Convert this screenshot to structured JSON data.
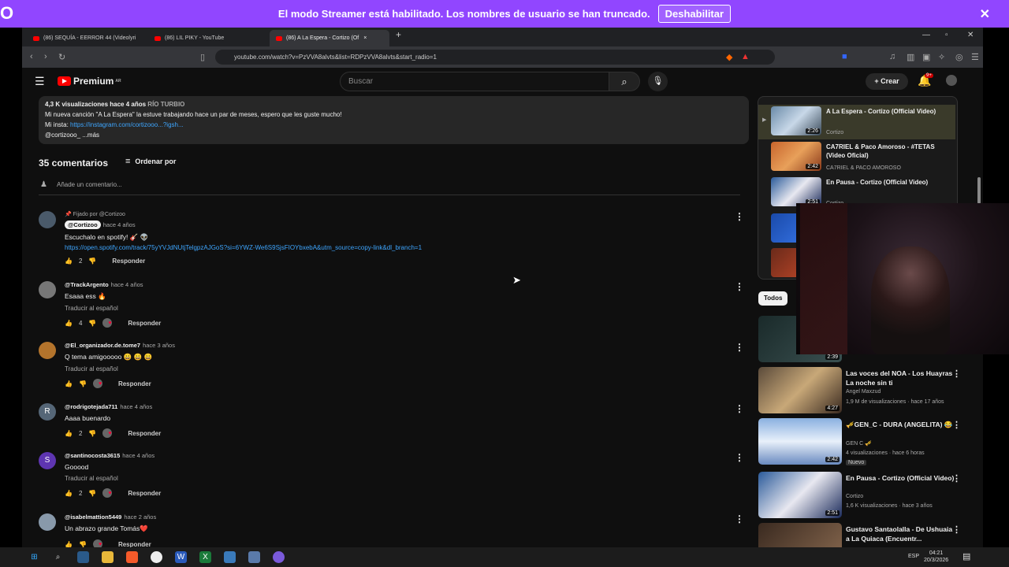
{
  "banner": {
    "logo": "O",
    "text": "El modo Streamer está habilitado. Los nombres de usuario se han truncado.",
    "button": "Deshabilitar",
    "close": "✕"
  },
  "browser": {
    "tabs": [
      "(86) SEQUÍA - EERROR 44 (Videolyri",
      "(86) LIL PIKY - YouTube",
      "(86) A La Espera - Cortizo (Of"
    ],
    "url": "youtube.com/watch?v=PzVVA8alvts&list=RDPzVVA8alvts&start_radio=1"
  },
  "youtube": {
    "logo_text": "Premium",
    "logo_sup": "AR",
    "search_placeholder": "Buscar",
    "create_label": "Crear",
    "notif_badge": "9+"
  },
  "description": {
    "meta": "4,3 K visualizaciones  hace 4 años",
    "tag": "RÍO TURBIO",
    "line1": "Mi nueva canción \"A La Espera\" la estuve trabajando hace un par de meses, espero que les guste mucho!",
    "line2_prefix": "Mi insta: ",
    "line2_link": "https://instagram.com/cortizooo...?igsh...",
    "line3": "@cortizooo_  ...más"
  },
  "comments_header": {
    "count": "35 comentarios",
    "sort": "Ordenar por",
    "add_placeholder": "Añade un comentario..."
  },
  "comments": [
    {
      "pinned": "Fijado por @Cortizoo",
      "author": "@Cortizoo",
      "time": "hace 4 años",
      "text": "Escuchalo en spotify! 🎸 👽",
      "link": "https://open.spotify.com/track/75yYVJdNUtjTelgpzAJGoS?si=6YWZ-We6S9SjsFIOYbxebA&utm_source=copy-link&dl_branch=1",
      "likes": "2",
      "reply": "Responder"
    },
    {
      "author": "@TrackArgento",
      "time": "hace 4 años",
      "text": "Esaaa ess 🔥",
      "translate": "Traducir al español",
      "likes": "4",
      "reply": "Responder"
    },
    {
      "author": "@El_organizador.de.tome7",
      "time": "hace 3 años",
      "text": "Q tema amigooooo 😀 😀 😀",
      "translate": "Traducir al español",
      "likes": "",
      "reply": "Responder"
    },
    {
      "author": "@rodrigotejada711",
      "time": "hace 4 años",
      "avatar_letter": "R",
      "text": "Aaaa buenardo",
      "likes": "2",
      "reply": "Responder"
    },
    {
      "author": "@santinocosta3615",
      "time": "hace 4 años",
      "avatar_letter": "S",
      "text": "Gooood",
      "translate": "Traducir al español",
      "likes": "2",
      "reply": "Responder"
    },
    {
      "author": "@isabelmattion5449",
      "time": "hace 2 años",
      "text": "Un abrazo grande Tomás❤️",
      "reply": "Responder"
    }
  ],
  "playlist": [
    {
      "title": "A La Espera - Cortizo (Official Video)",
      "channel": "Cortizo",
      "duration": "2:26"
    },
    {
      "title": "CA7RIEL & Paco Amoroso - #TETAS (Video Oficial)",
      "channel": "CA7RIEL & PACO AMOROSO",
      "duration": "2:42"
    },
    {
      "title": "En Pausa - Cortizo (Official Video)",
      "channel": "Cortizo",
      "duration": "2:51"
    }
  ],
  "filter_chip": "Todos",
  "recommendations": [
    {
      "title": "",
      "duration": "2:39"
    },
    {
      "title": "Las voces del NOA - Los Huayras   La noche sin ti",
      "channel": "Angel Maxzud",
      "meta": "1,9 M de visualizaciones · hace 17 años",
      "duration": "4:27"
    },
    {
      "title": "🎺GEN_C - DURA (ANGELITA) 😂",
      "channel": "GEN C 🎺",
      "meta": "4 visualizaciones · hace 6 horas",
      "badge": "Nuevo",
      "duration": "2:42"
    },
    {
      "title": "En Pausa - Cortizo (Official Video)",
      "channel": "Cortizo",
      "meta": "1,6 K visualizaciones · hace 3 años",
      "duration": "2:51"
    },
    {
      "title": "Gustavo Santaolalla - De Ushuaia a La Quiaca (Encuentr...",
      "channel": "",
      "meta": "",
      "duration": ""
    }
  ],
  "taskbar": {
    "lang": "ESP",
    "time": "04:21",
    "date": "20/3/2026"
  },
  "colors": {
    "banner": "#9146ff",
    "yt_red": "#ff0000",
    "link": "#3ea6ff"
  }
}
